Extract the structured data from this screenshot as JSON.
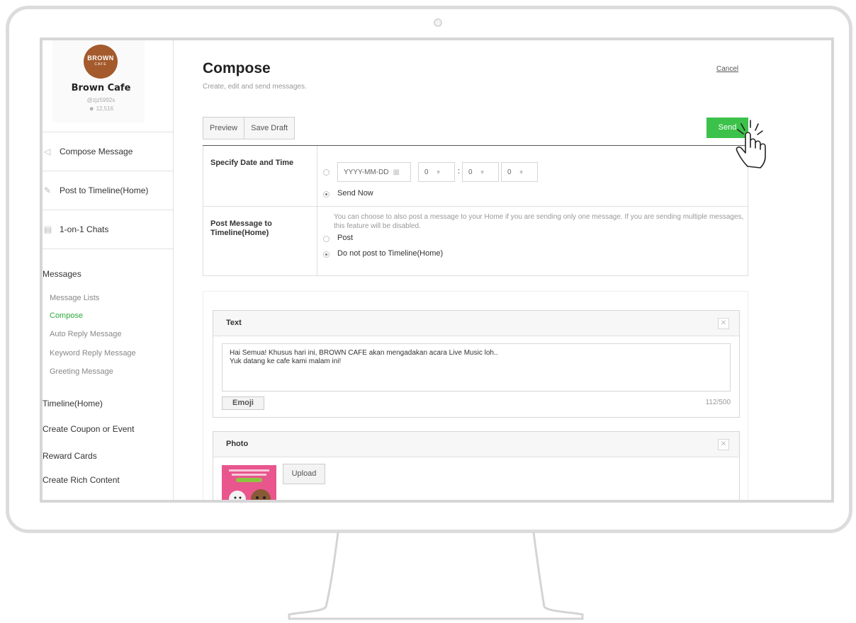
{
  "profile": {
    "logo_line1": "BROWN",
    "logo_line2": "CAFE",
    "name": "Brown Cafe",
    "id": "@zjz5992s",
    "followers": "12,516"
  },
  "sidebar": {
    "main_items": [
      {
        "label": "Compose Message",
        "icon": "megaphone-icon"
      },
      {
        "label": "Post to Timeline(Home)",
        "icon": "edit-icon"
      },
      {
        "label": "1-on-1 Chats",
        "icon": "chat-icon"
      }
    ],
    "messages_heading": "Messages",
    "message_items": [
      "Message Lists",
      "Compose",
      "Auto Reply Message",
      "Keyword Reply Message",
      "Greeting Message"
    ],
    "sections": [
      "Timeline(Home)",
      "Create Coupon or Event",
      "Reward Cards",
      "Create Rich Content"
    ]
  },
  "header": {
    "title": "Compose",
    "subtitle": "Create, edit and send messages.",
    "cancel": "Cancel"
  },
  "toolbar": {
    "preview": "Preview",
    "save_draft": "Save Draft",
    "send": "Send"
  },
  "schedule": {
    "label": "Specify Date and Time",
    "date_placeholder": "YYYY-MM-DD",
    "hour": "0",
    "minute": "0",
    "second": "0",
    "colon": ":",
    "send_now": "Send Now",
    "selected": "send_now"
  },
  "timeline_post": {
    "label": "Post Message to Timeline(Home)",
    "description": "You can choose to also post a message to your Home if you are sending only one message. If you are sending multiple messages, this feature will be disabled.",
    "option_post": "Post",
    "option_no_post": "Do not post to Timeline(Home)",
    "selected": "no_post"
  },
  "text_card": {
    "title": "Text",
    "content": "Hai Semua! Khusus hari ini, BROWN CAFE akan mengadakan acara Live Music loh..\nYuk datang ke cafe kami malam ini!",
    "emoji_button": "Emoji",
    "counter": "112/500"
  },
  "photo_card": {
    "title": "Photo",
    "upload_button": "Upload"
  },
  "colors": {
    "send_green": "#3cc24b",
    "active_green": "#2eaa3c",
    "logo_brown": "#a45a2c"
  }
}
